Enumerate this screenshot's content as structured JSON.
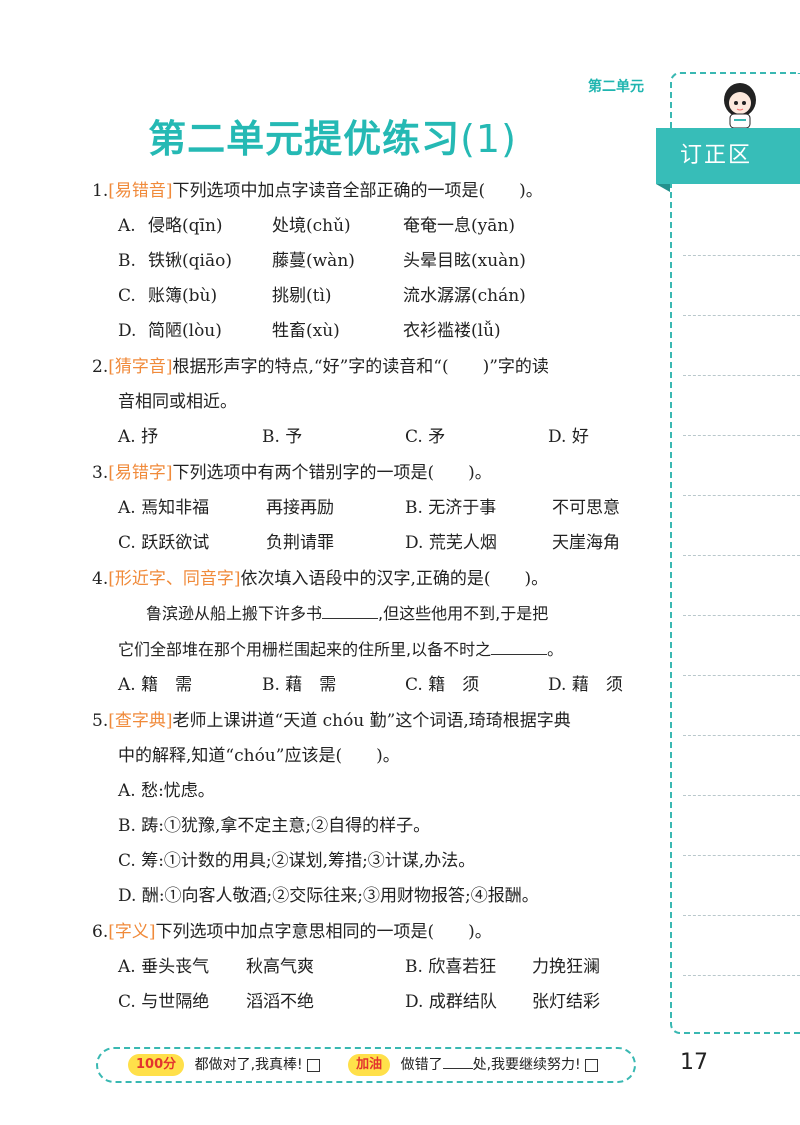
{
  "header": {
    "unit_tag": "第二单元",
    "title_main": "第二单元提优练习",
    "title_num": "(1)"
  },
  "correction": {
    "label": "订正区"
  },
  "q1": {
    "num": "1.",
    "tag": "[易错音]",
    "stem": "下列选项中加点字读音全部正确的一项是(　　)。",
    "A": [
      "A.",
      "侵略(qīn)",
      "处境(chǔ)",
      "奄奄一息(yān)"
    ],
    "B": [
      "B.",
      "铁锹(qiāo)",
      "藤蔓(wàn)",
      "头晕目眩(xuàn)"
    ],
    "C": [
      "C.",
      "账簿(bù)",
      "挑剔(tì)",
      "流水潺潺(chán)"
    ],
    "D": [
      "D.",
      "简陋(lòu)",
      "牲畜(xù)",
      "衣衫褴褛(lǚ)"
    ]
  },
  "q2": {
    "num": "2.",
    "tag": "[猜字音]",
    "stem": "根据形声字的特点,“好”字的读音和“(　　)”字的读",
    "stem2": "音相同或相近。",
    "opts": [
      "A. 抒",
      "B. 予",
      "C. 矛",
      "D. 好"
    ]
  },
  "q3": {
    "num": "3.",
    "tag": "[易错字]",
    "stem": "下列选项中有两个错别字的一项是(　　)。",
    "row1": [
      "A. 焉知非福",
      "再接再励",
      "B. 无济于事",
      "不可思意"
    ],
    "row2": [
      "C. 跃跃欲试",
      "负荆请罪",
      "D. 荒芜人烟",
      "天崖海角"
    ]
  },
  "q4": {
    "num": "4.",
    "tag": "[形近字、同音字]",
    "stem": "依次填入语段中的汉字,正确的是(　　)。",
    "p1a": "鲁滨逊从船上搬下许多书",
    "p1b": ",但这些他用不到,于是把",
    "p2a": "它们全部堆在那个用栅栏围起来的住所里,以备不时之",
    "p2b": "。",
    "opts": [
      "A. 籍　需",
      "B. 藉　需",
      "C. 籍　须",
      "D. 藉　须"
    ]
  },
  "q5": {
    "num": "5.",
    "tag": "[查字典]",
    "stem": "老师上课讲道“天道 chóu 勤”这个词语,琦琦根据字典",
    "stem2": "中的解释,知道“chóu”应该是(　　)。",
    "opts": [
      "A. 愁:忧虑。",
      "B. 踌:①犹豫,拿不定主意;②自得的样子。",
      "C. 筹:①计数的用具;②谋划,筹措;③计谋,办法。",
      "D. 酬:①向客人敬酒;②交际往来;③用财物报答;④报酬。"
    ]
  },
  "q6": {
    "num": "6.",
    "tag": "[字义]",
    "stem": "下列选项中加点字意思相同的一项是(　　)。",
    "row1": [
      "A. 垂头丧气",
      "秋高气爽",
      "B. 欣喜若狂",
      "力挽狂澜"
    ],
    "row2": [
      "C. 与世隔绝",
      "滔滔不绝",
      "D. 成群结队",
      "张灯结彩"
    ]
  },
  "footer": {
    "badge1": "100分",
    "text1": "都做对了,我真棒!",
    "badge2": "加油",
    "text2a": "做错了",
    "text2b": "处,我要继续努力!"
  },
  "page_number": "17"
}
